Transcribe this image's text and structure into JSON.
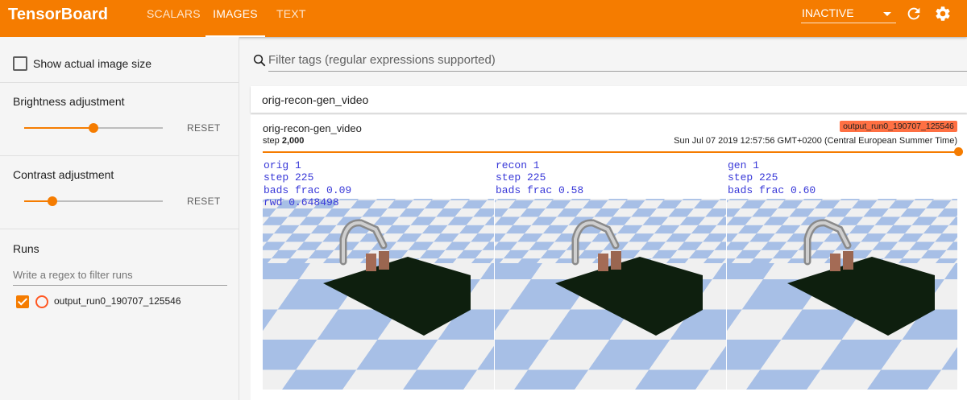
{
  "app": {
    "title": "TensorBoard"
  },
  "tabs": [
    {
      "label": "SCALARS",
      "active": false
    },
    {
      "label": "IMAGES",
      "active": true
    },
    {
      "label": "TEXT",
      "active": false
    }
  ],
  "header": {
    "status_select": "INACTIVE",
    "reload_icon": "refresh-icon",
    "settings_icon": "gear-icon"
  },
  "sidebar": {
    "show_size": {
      "label": "Show actual image size",
      "checked": false
    },
    "brightness": {
      "title": "Brightness adjustment",
      "value": 0.5,
      "reset": "RESET"
    },
    "contrast": {
      "title": "Contrast adjustment",
      "value": 0.2,
      "reset": "RESET"
    },
    "runs": {
      "title": "Runs",
      "filter_placeholder": "Write a regex to filter runs",
      "items": [
        {
          "label": "output_run0_190707_125546",
          "checked": true,
          "color": "#ff5722"
        }
      ]
    }
  },
  "main": {
    "filter_placeholder": "Filter tags (regular expressions supported)",
    "card_title": "orig-recon-gen_video",
    "image_card": {
      "tag": "orig-recon-gen_video",
      "step_label": "step",
      "step_value": "2,000",
      "run_badge": "output_run0_190707_125546",
      "timestamp": "Sun Jul 07 2019 12:57:56 GMT+0200 (Central European Summer Time)",
      "panels": [
        {
          "lines": [
            "orig 1",
            "step 225",
            "bads frac 0.09",
            "rwd 0.648498"
          ]
        },
        {
          "lines": [
            "recon 1",
            "step 225",
            "bads frac 0.58"
          ]
        },
        {
          "lines": [
            "gen 1",
            "step 225",
            "bads frac 0.60"
          ]
        }
      ]
    }
  },
  "colors": {
    "accent": "#f57c00",
    "run": "#ff5722",
    "checker": "#a7bfe6",
    "table": "#0e1f0e"
  }
}
